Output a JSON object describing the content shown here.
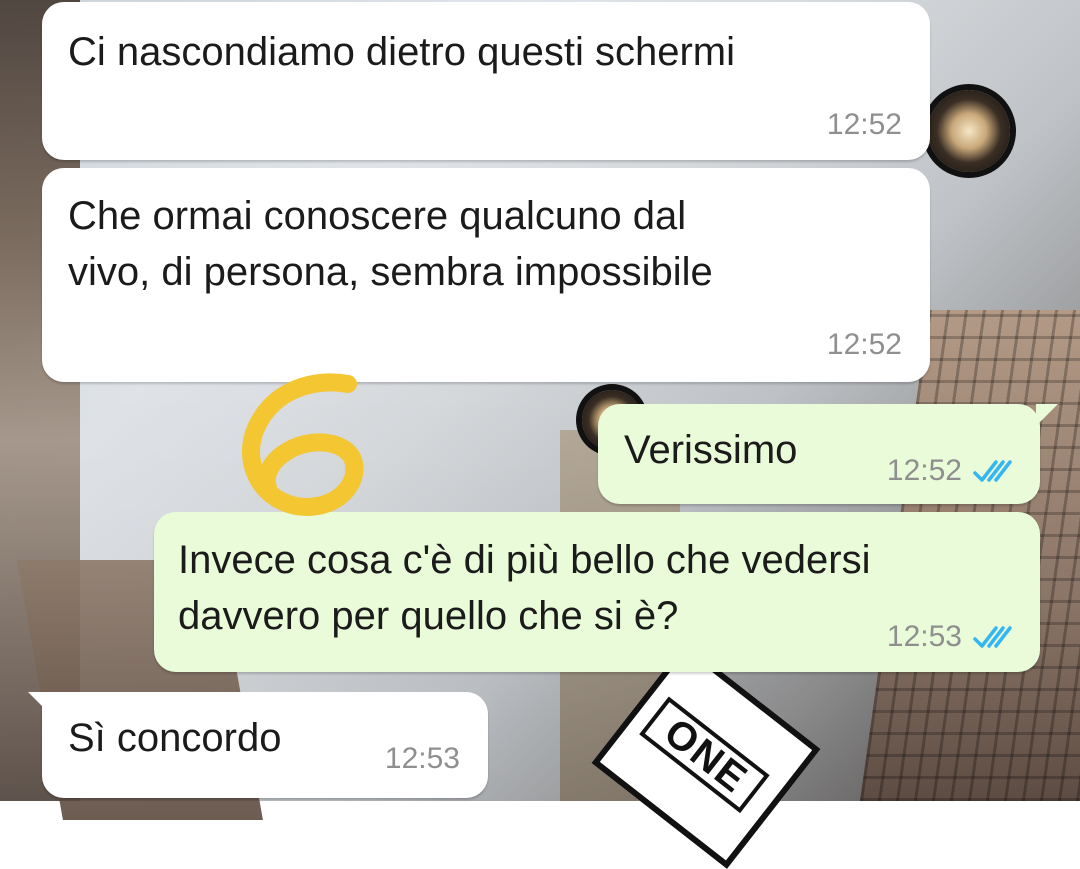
{
  "messages": [
    {
      "direction": "incoming",
      "text": "Ci nascondiamo dietro questi schermi",
      "time": "12:52"
    },
    {
      "direction": "incoming",
      "text": "Che ormai conoscere qualcuno dal\nvivo, di persona, sembra impossibile",
      "time": "12:52"
    },
    {
      "direction": "outgoing",
      "text": "Verissimo",
      "time": "12:52",
      "status": "read"
    },
    {
      "direction": "outgoing",
      "text": "Invece cosa c'è di più bello che vedersi\ndavvero per quello che si è?",
      "time": "12:53",
      "status": "read"
    },
    {
      "direction": "incoming",
      "text": "Sì concordo",
      "time": "12:53"
    }
  ],
  "annotation": {
    "text": "6",
    "color": "#f3c632"
  },
  "wallpaper": {
    "sign_text": "ONE"
  },
  "colors": {
    "incoming_bubble": "#ffffff",
    "outgoing_bubble": "#e9fbd9",
    "read_ticks": "#34b7f1",
    "timestamp": "#8f8f8f"
  }
}
